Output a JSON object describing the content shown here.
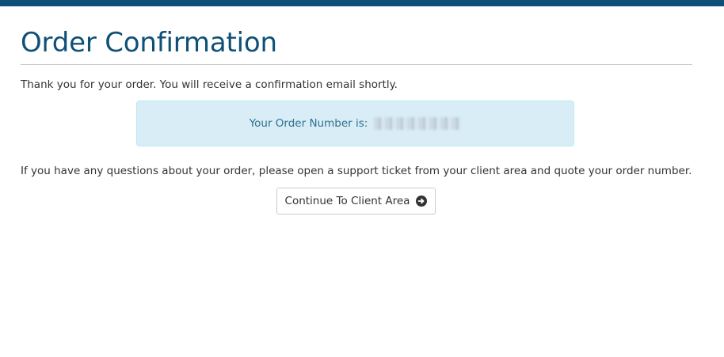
{
  "page": {
    "title": "Order Confirmation",
    "thanks_text": "Thank you for your order. You will receive a confirmation email shortly.",
    "order_number_label": "Your Order Number is:",
    "questions_text": "If you have any questions about your order, please open a support ticket from your client area and quote your order number.",
    "continue_button_label": "Continue To Client Area"
  },
  "colors": {
    "brand": "#0e5077",
    "info_bg": "#d9edf7",
    "info_text": "#31708f"
  },
  "icons": {
    "continue": "arrow-circle-right-icon"
  }
}
